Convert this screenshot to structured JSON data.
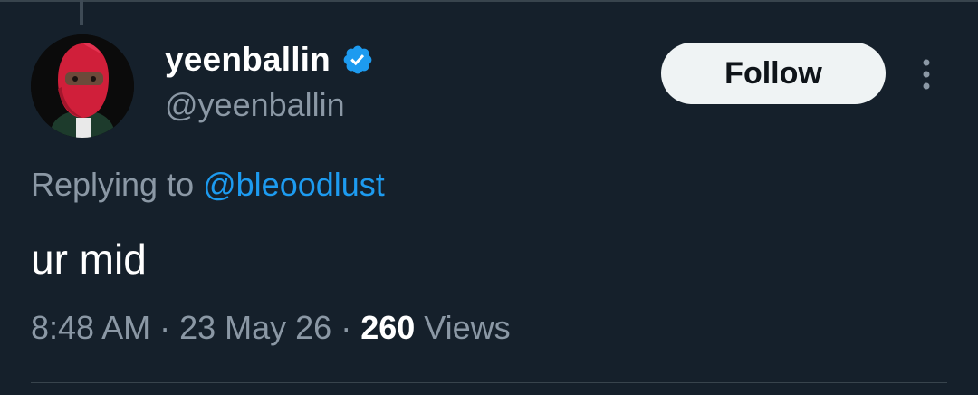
{
  "colors": {
    "background": "#15202b",
    "primary_text": "#ffffff",
    "secondary_text": "#8b98a5",
    "accent": "#1d9bf0",
    "follow_button_bg": "#eff3f4",
    "divider": "#38444d"
  },
  "author": {
    "display_name": "yeenballin",
    "handle": "@yeenballin",
    "verified": true,
    "verified_icon": "verified-badge-icon",
    "avatar": "avatar-red-ski-mask"
  },
  "actions": {
    "follow_label": "Follow",
    "more_icon": "more-vertical-icon"
  },
  "reply": {
    "prefix": "Replying to ",
    "mention": "@bleoodlust"
  },
  "tweet": {
    "text": "ur mid"
  },
  "meta": {
    "time": "8:48 AM",
    "separator": " · ",
    "date": "23 May 26",
    "views_count": "260",
    "views_label": " Views"
  }
}
